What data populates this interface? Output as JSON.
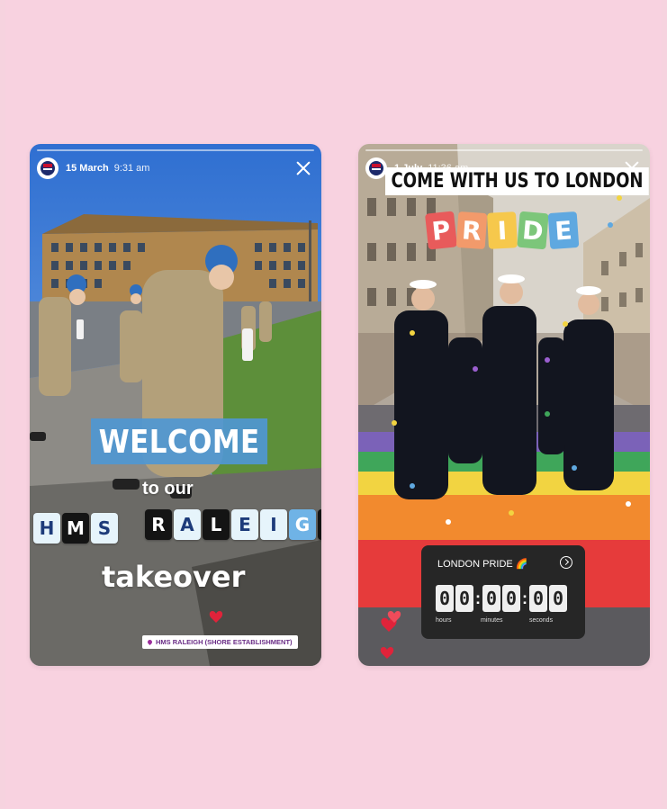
{
  "story1": {
    "date": "15 March",
    "time": "9:31 am",
    "welcome": "WELCOME",
    "to_our": "to our",
    "word_hms": [
      "H",
      "M",
      "S"
    ],
    "word_raleigh": [
      "R",
      "A",
      "L",
      "E",
      "I",
      "G",
      "H"
    ],
    "takeover": "takeover",
    "location": "HMS RALEIGH (SHORE ESTABLISHMENT)"
  },
  "story2": {
    "date": "1 July",
    "time": "11:36 am",
    "headline": "COME WITH US TO LONDON",
    "pride_letters": [
      "P",
      "R",
      "I",
      "D",
      "E"
    ],
    "pride_colors": [
      "#e85b5b",
      "#f29a6b",
      "#f6c84c",
      "#7cc67a",
      "#5fa8e0"
    ],
    "countdown": {
      "title": "LONDON PRIDE 🌈",
      "digits": [
        "0",
        "0",
        "0",
        "0",
        "0",
        "0"
      ],
      "labels": [
        "hours",
        "minutes",
        "seconds"
      ]
    }
  },
  "colors": {
    "background": "#f8d2e0",
    "welcome_blue": "#4f97d2",
    "location_purple": "#6a2d86"
  },
  "icons": [
    "navy-logo-icon",
    "close-icon",
    "pin-icon",
    "chevron-right-icon",
    "heart-icon"
  ]
}
